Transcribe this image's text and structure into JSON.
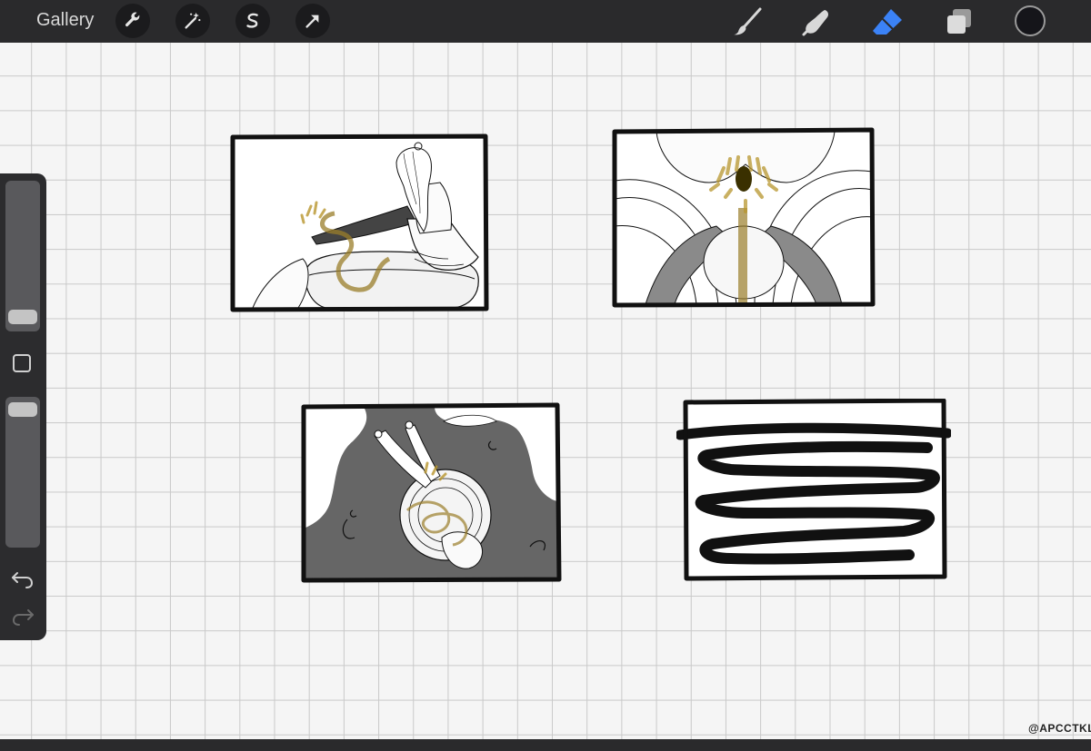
{
  "header": {
    "gallery_label": "Gallery"
  },
  "left_tools": [
    "wrench-icon",
    "magic-wand-icon",
    "selection-s-icon",
    "transform-arrow-icon"
  ],
  "right_tools": [
    "brush-icon",
    "smudge-icon",
    "eraser-icon",
    "layers-icon"
  ],
  "colors": {
    "toolbar": "#2a2a2c",
    "active_tool": "#3b82f6",
    "current_color": "#15151a",
    "ink": "#111111",
    "panel_gray": "#6b6b6b",
    "highlight_gold": "#9a7d2a"
  },
  "sidebar": {
    "brush_size_level": 0.12,
    "opacity_level": 0.95
  },
  "watermark": "@APCCTKL"
}
